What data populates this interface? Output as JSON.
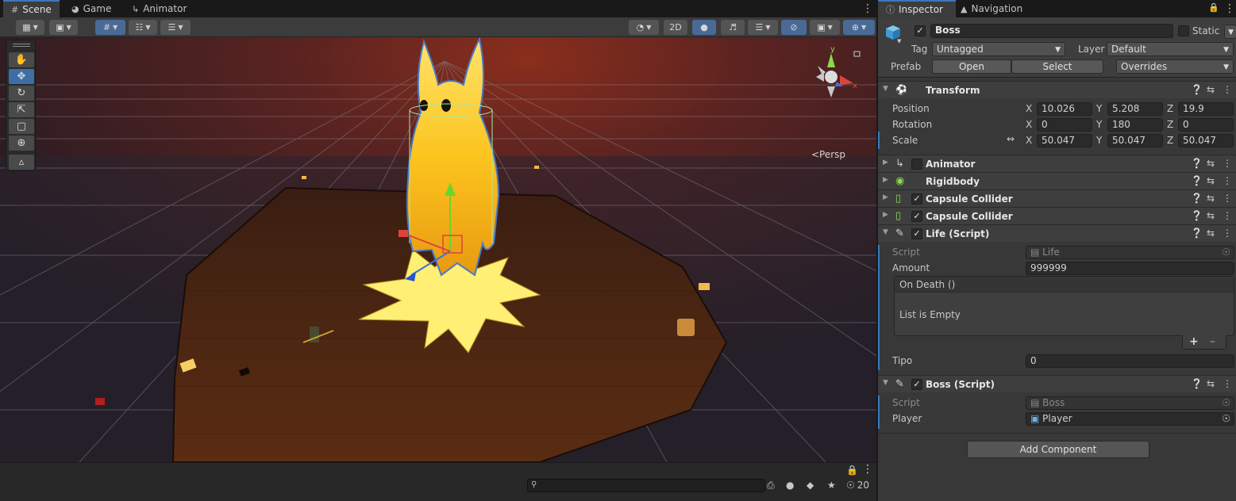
{
  "scene_tabs": [
    {
      "label": "Scene",
      "icon": "grid-icon"
    },
    {
      "label": "Game",
      "icon": "gamepad-icon"
    },
    {
      "label": "Animator",
      "icon": "animator-icon"
    }
  ],
  "scene_toolbar": {
    "mode_2d": "2D"
  },
  "viewport": {
    "projection_label": "<Persp"
  },
  "bottom_bar": {
    "search_value": "",
    "hidden_count": "20"
  },
  "inspector_tabs": [
    {
      "label": "Inspector",
      "icon": "info-icon"
    },
    {
      "label": "Navigation",
      "icon": "navigation-icon"
    }
  ],
  "game_object": {
    "active": true,
    "name": "Boss",
    "static_label": "Static",
    "static_checked": false,
    "tag_label": "Tag",
    "tag_value": "Untagged",
    "layer_label": "Layer",
    "layer_value": "Default",
    "prefab_label": "Prefab",
    "prefab_open": "Open",
    "prefab_select": "Select",
    "prefab_overrides": "Overrides"
  },
  "transform": {
    "title": "Transform",
    "rows": [
      {
        "label": "Position",
        "x": "10.026",
        "y": "5.208",
        "z": "19.9"
      },
      {
        "label": "Rotation",
        "x": "0",
        "y": "180",
        "z": "0"
      },
      {
        "label": "Scale",
        "x": "50.047",
        "y": "50.047",
        "z": "50.047"
      }
    ],
    "axis_x": "X",
    "axis_y": "Y",
    "axis_z": "Z"
  },
  "components": [
    {
      "title": "Animator",
      "enabled": false,
      "has_checkbox": true,
      "icon": "animator-icon"
    },
    {
      "title": "Rigidbody",
      "has_checkbox": false,
      "icon": "rigidbody-icon"
    },
    {
      "title": "Capsule Collider",
      "enabled": true,
      "has_checkbox": true,
      "icon": "capsule-collider-icon"
    },
    {
      "title": "Capsule Collider",
      "enabled": true,
      "has_checkbox": true,
      "icon": "capsule-collider-icon"
    }
  ],
  "life_script": {
    "title": "Life (Script)",
    "enabled": true,
    "script_label": "Script",
    "script_value": "Life",
    "amount_label": "Amount",
    "amount_value": "999999",
    "event_title": "On Death ()",
    "event_empty": "List is Empty",
    "add_symbol": "+",
    "remove_symbol": "–",
    "tipo_label": "Tipo",
    "tipo_value": "0"
  },
  "boss_script": {
    "title": "Boss (Script)",
    "enabled": true,
    "script_label": "Script",
    "script_value": "Boss",
    "player_label": "Player",
    "player_value": "Player"
  },
  "add_component_label": "Add Component",
  "colors": {
    "accent": "#3a79bb",
    "tab_bar": "#191919",
    "panel": "#383838",
    "axis_x": "#e0433a",
    "axis_y": "#8bd84b",
    "axis_z": "#3a72e0"
  }
}
